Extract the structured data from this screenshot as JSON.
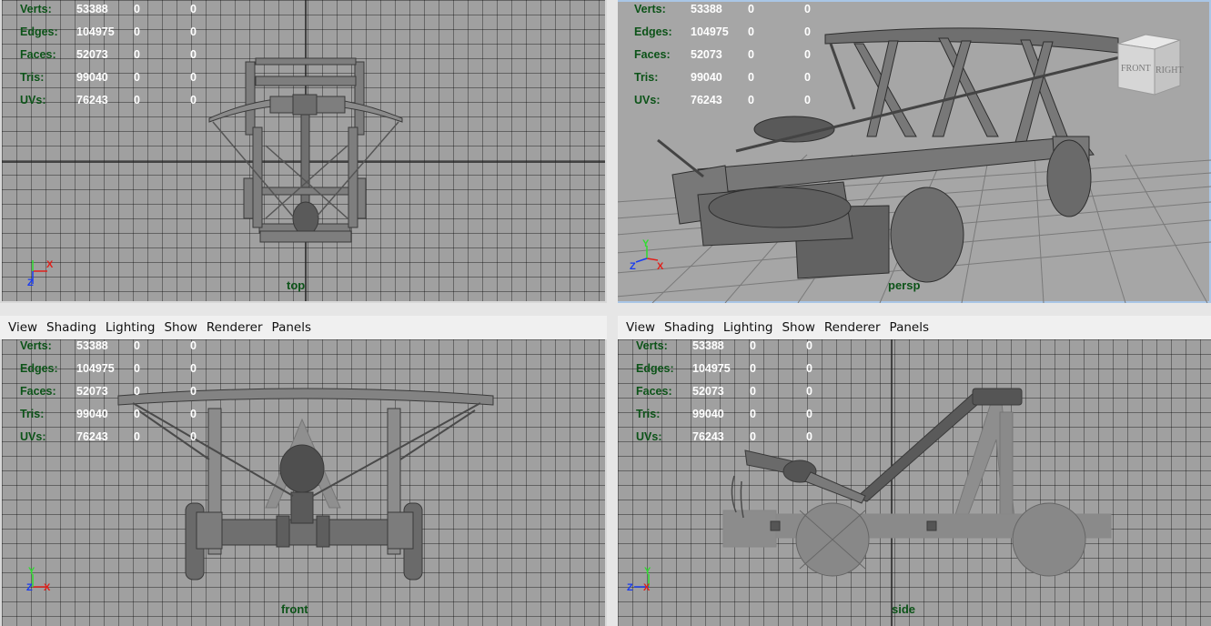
{
  "menu": {
    "items": [
      "View",
      "Shading",
      "Lighting",
      "Show",
      "Renderer",
      "Panels"
    ]
  },
  "hud": {
    "rows": [
      {
        "label": "Verts:",
        "v1": "53388",
        "v2": "0",
        "v3": "0"
      },
      {
        "label": "Edges:",
        "v1": "104975",
        "v2": "0",
        "v3": "0"
      },
      {
        "label": "Faces:",
        "v1": "52073",
        "v2": "0",
        "v3": "0"
      },
      {
        "label": "Tris:",
        "v1": "99040",
        "v2": "0",
        "v3": "0"
      },
      {
        "label": "UVs:",
        "v1": "76243",
        "v2": "0",
        "v3": "0"
      }
    ]
  },
  "viewports": {
    "top": {
      "label": "top"
    },
    "persp": {
      "label": "persp"
    },
    "front": {
      "label": "front"
    },
    "side": {
      "label": "side"
    }
  },
  "view_cube": {
    "front": "FRONT",
    "right": "RIGHT"
  },
  "axes": {
    "x": "X",
    "y": "Y",
    "z": "Z"
  },
  "colors": {
    "hud_label": "#0c5318",
    "hud_value": "#ffffff",
    "axis_x": "#e0201a",
    "axis_y": "#2fdc2f",
    "axis_z": "#1a3cf0",
    "active_border": "#a9c6e6"
  }
}
